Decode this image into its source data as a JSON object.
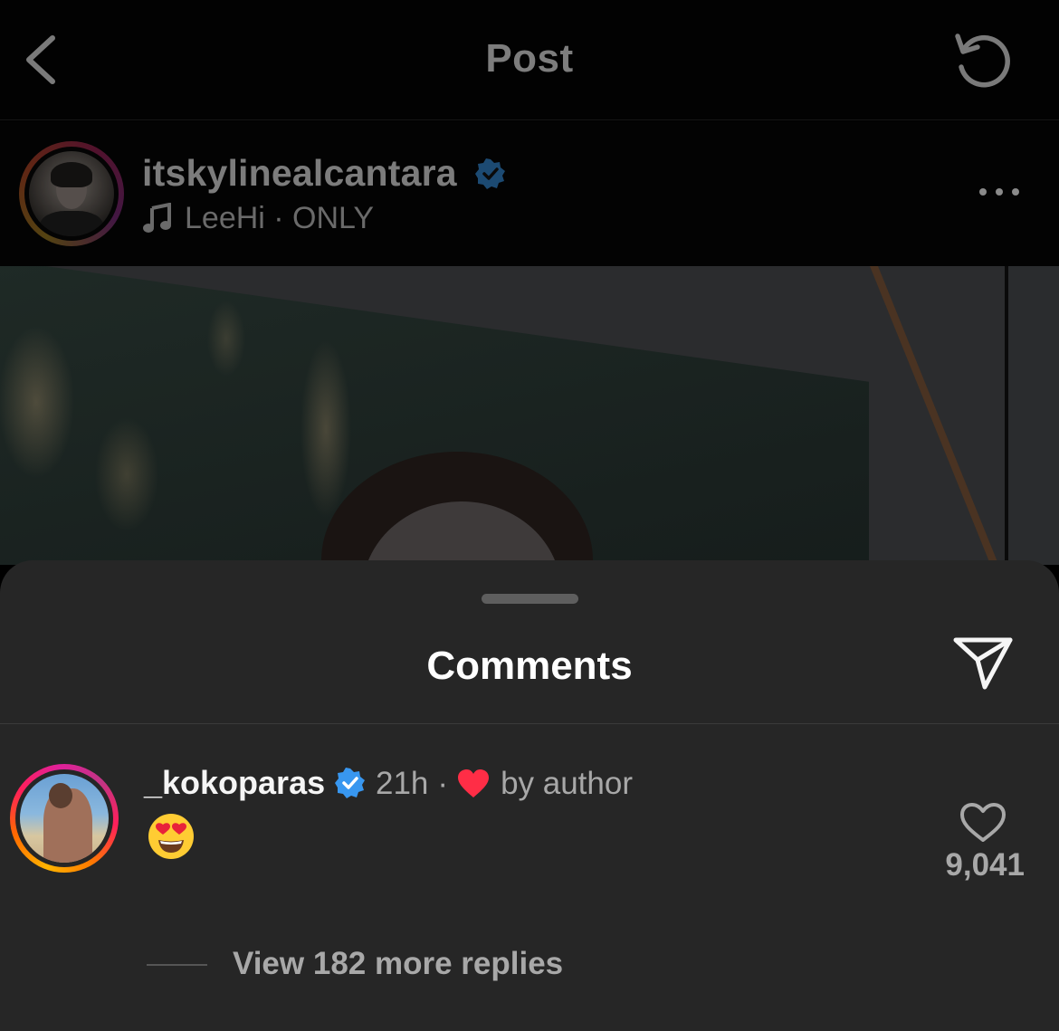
{
  "header": {
    "title": "Post",
    "back_icon": "chevron-left-icon",
    "refresh_icon": "refresh-icon"
  },
  "post": {
    "username": "itskylinealcantara",
    "verified": true,
    "music": "LeeHi · ONLY",
    "music_icon": "music-note-icon",
    "more_icon": "more-horizontal-icon"
  },
  "comments_sheet": {
    "title": "Comments",
    "share_icon": "send-icon",
    "comment": {
      "username": "_koko paras",
      "verified": true,
      "time": "21h",
      "separator": "·",
      "liked_by": "by author",
      "text_emoji": "smiling-face-with-heart-eyes",
      "like_count": "9,041",
      "view_replies": "View 182 more replies"
    }
  },
  "colors": {
    "verified_blue": "#3897f0",
    "heart_red": "#ff2d46",
    "sheet_bg": "#262626"
  }
}
